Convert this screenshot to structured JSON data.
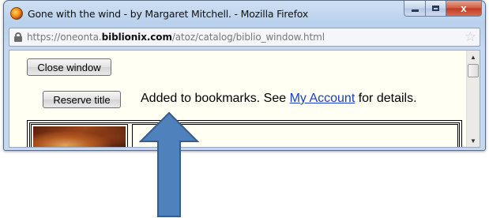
{
  "window": {
    "title": "Gone with the wind - by Margaret Mitchell. - Mozilla Firefox",
    "caption_buttons": {
      "minimize_icon": "minimize-icon",
      "maximize_icon": "maximize-icon",
      "close_label": "x"
    }
  },
  "address_bar": {
    "protocol": "https://",
    "subdomain": "oneonta.",
    "domain": "biblionix.com",
    "path": "/atoz/catalog/biblio_window.html",
    "lock_icon": "lock-icon",
    "bookmark_icon": "star-icon"
  },
  "content": {
    "close_button_label": "Close window",
    "reserve_button_label": "Reserve title",
    "message_prefix": "Added to bookmarks. See ",
    "message_link": "My Account",
    "message_suffix": " for details.",
    "link_color": "#1a3ec2"
  },
  "annotation": {
    "arrow_color": "#4f81bd",
    "arrow_outline": "#385d8a"
  }
}
